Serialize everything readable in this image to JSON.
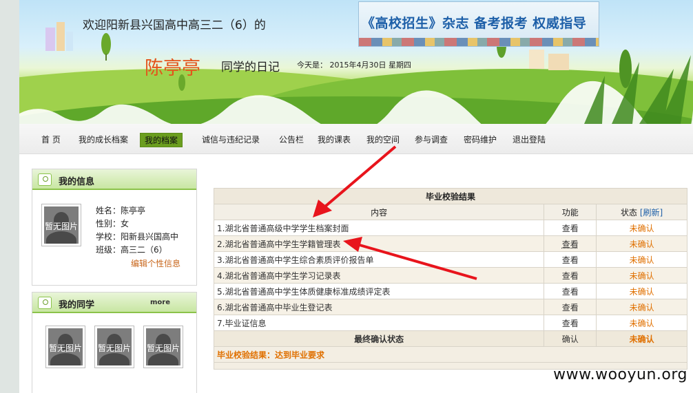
{
  "header": {
    "welcome": "欢迎阳新县兴国高中高三二（6）的",
    "student_name": "陈亭亭",
    "diary_label": "同学的日记",
    "today": "今天是：  2015年4月30日  星期四",
    "banner_text": "《高校招生》杂志  备考报考 权威指导"
  },
  "nav": {
    "items": [
      "首 页",
      "我的成长档案",
      "我的档案",
      "诚信与违纪记录",
      "公告栏",
      "我的课表",
      "我的空间",
      "参与调查",
      "密码维护",
      "退出登陆"
    ],
    "active": "我的档案"
  },
  "my_info": {
    "title": "我的信息",
    "avatar_label": "暂无图片",
    "name": "姓名：陈亭亭",
    "gender": "性别：女",
    "school": "学校：阳新县兴国高中",
    "class": "班级：高三二（6）",
    "edit_link": "编辑个性信息"
  },
  "classmates": {
    "title": "我的同学",
    "more": "more",
    "avatars": [
      "暂无图片",
      "暂无图片",
      "暂无图片"
    ]
  },
  "result_table": {
    "title": "毕业校验结果",
    "col_content": "内容",
    "col_function": "功能",
    "col_status": "状态",
    "refresh": "[刷新]",
    "rows": [
      {
        "content": "1.湖北省普通高级中学学生档案封面",
        "function": "查看",
        "status": "未确认"
      },
      {
        "content": "2.湖北省普通高中学生学籍管理表",
        "function": "查看",
        "status": "未确认"
      },
      {
        "content": "3.湖北省普通高中学生综合素质评价报告单",
        "function": "查看",
        "status": "未确认"
      },
      {
        "content": "4.湖北省普通高中学生学习记录表",
        "function": "查看",
        "status": "未确认"
      },
      {
        "content": "5.湖北省普通高中学生体质健康标准成绩评定表",
        "function": "查看",
        "status": "未确认"
      },
      {
        "content": "6.湖北省普通高中毕业生登记表",
        "function": "查看",
        "status": "未确认"
      },
      {
        "content": "7.毕业证信息",
        "function": "查看",
        "status": "未确认"
      }
    ],
    "final_label": "最终确认状态",
    "final_function": "确认",
    "final_status": "未确认",
    "summary": "毕业校验结果：达到毕业要求"
  },
  "watermark": "www.wooyun.org",
  "colors": {
    "accent_green": "#8bc34a",
    "nav_active": "#6b9e1f",
    "name_orange": "#e4531b",
    "status_orange": "#e07000",
    "arrow_red": "#e8141c"
  }
}
